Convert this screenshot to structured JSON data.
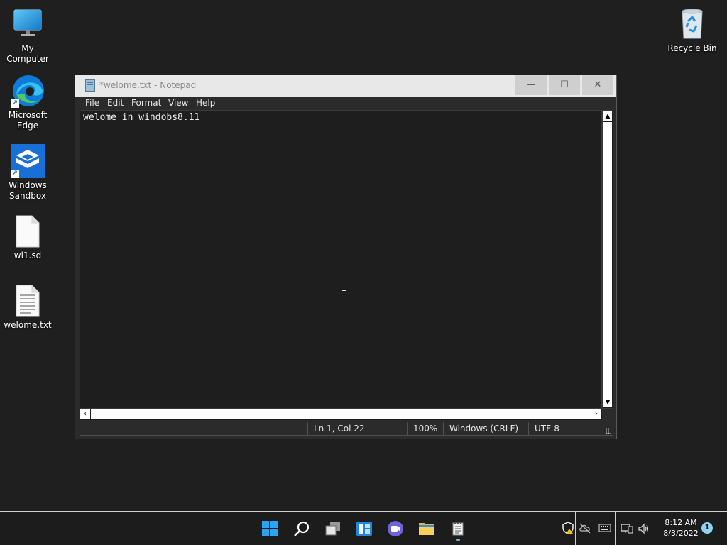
{
  "desktop": {
    "icons": [
      {
        "label": "My Computer"
      },
      {
        "label": "Microsoft Edge"
      },
      {
        "label": "Windows Sandbox"
      },
      {
        "label": "wi1.sd"
      },
      {
        "label": "welome.txt"
      },
      {
        "label": "Recycle Bin"
      }
    ]
  },
  "notepad": {
    "title": "*welome.txt - Notepad",
    "menu": [
      "File",
      "Edit",
      "Format",
      "View",
      "Help"
    ],
    "content": "welome in windobs8.11",
    "status": {
      "position": "Ln 1, Col 22",
      "zoom": "100%",
      "line_ending": "Windows (CRLF)",
      "encoding": "UTF-8"
    },
    "controls": {
      "minimize": "—",
      "maximize": "☐",
      "close": "✕"
    }
  },
  "taskbar": {
    "pinned": [
      "start-icon",
      "search-icon",
      "task-view-icon",
      "widgets-icon",
      "chat-icon",
      "file-explorer-icon",
      "notepad-icon"
    ],
    "clock": {
      "time": "8:12 AM",
      "date": "8/3/2022"
    },
    "notification_count": "1"
  },
  "colors": {
    "desktop": "#1f1f1f",
    "accent": "#0a84d6"
  }
}
